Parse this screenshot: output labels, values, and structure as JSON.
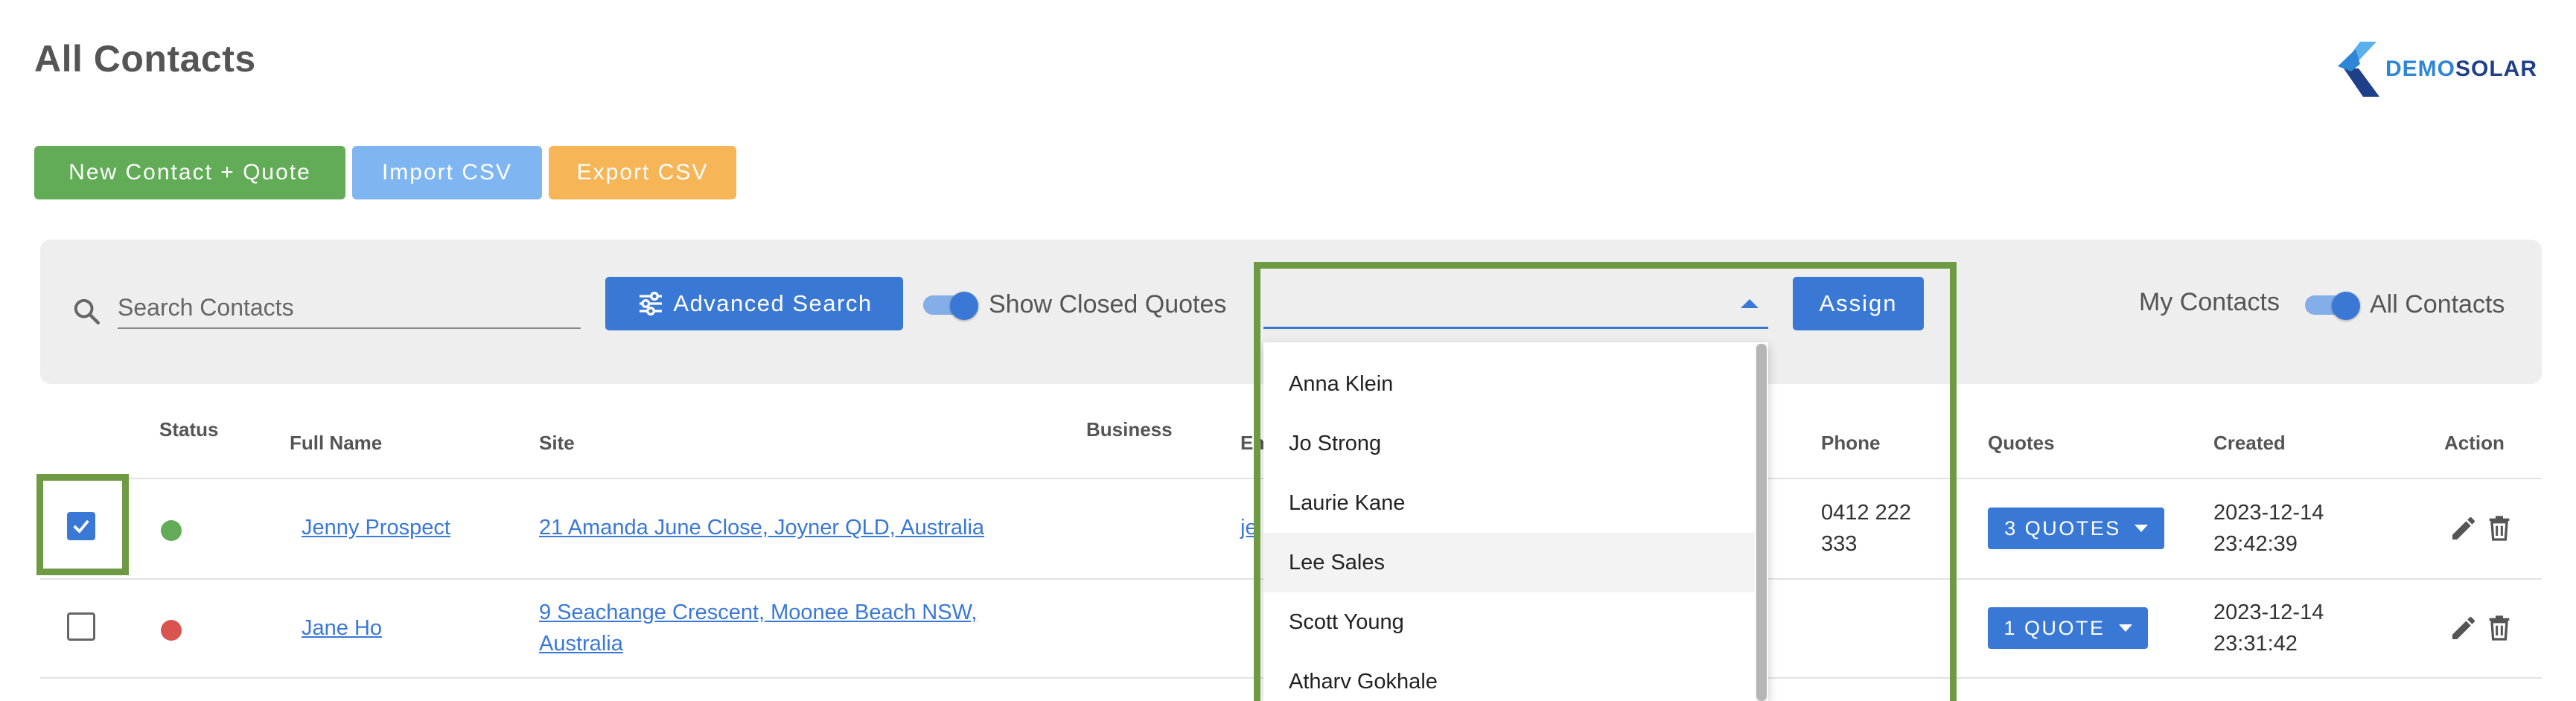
{
  "page": {
    "title": "All Contacts"
  },
  "logo": {
    "text_part1": "DEMO",
    "text_part2": "SOLAR"
  },
  "actions": {
    "new_contact": "New Contact + Quote",
    "import_csv": "Import CSV",
    "export_csv": "Export CSV"
  },
  "toolbar": {
    "search_placeholder": "Search Contacts",
    "advanced_search": "Advanced Search",
    "show_closed_quotes_label": "Show Closed Quotes",
    "show_closed_quotes_on": true,
    "assign_select_value": "",
    "assign_button": "Assign",
    "my_contacts_label": "My Contacts",
    "all_contacts_label": "All Contacts",
    "all_contacts_on": true
  },
  "assign_dropdown": {
    "options": [
      "Anna Klein",
      "Jo Strong",
      "Laurie Kane",
      "Lee Sales",
      "Scott Young",
      "Atharv Gokhale"
    ],
    "hovered": "Lee Sales"
  },
  "table": {
    "columns": {
      "status": "Status",
      "full_name": "Full Name",
      "site": "Site",
      "business": "Business",
      "email": "Email",
      "phone": "Phone",
      "quotes": "Quotes",
      "created": "Created",
      "action": "Action"
    },
    "rows": [
      {
        "selected": true,
        "status_color": "#62ac58",
        "full_name": "Jenny Prospect",
        "site": "21 Amanda June Close, Joyner QLD, Australia",
        "business": "",
        "email_visible": "je",
        "phone_line1": "0412 222",
        "phone_line2": "333",
        "quotes_label": "3 QUOTES",
        "created_date": "2023-12-14",
        "created_time": "23:42:39"
      },
      {
        "selected": false,
        "status_color": "#d9534f",
        "full_name": "Jane Ho",
        "site_line1": "9 Seachange Crescent, Moonee Beach NSW,",
        "site_line2": "Australia",
        "business": "",
        "email_visible": "",
        "phone_line1": "",
        "phone_line2": "",
        "quotes_label": "1 QUOTE",
        "created_date": "2023-12-14",
        "created_time": "23:31:42"
      }
    ]
  },
  "colors": {
    "primary": "#3a78d6",
    "success": "#62ac58",
    "info": "#7fb6f1",
    "warning": "#f6b658",
    "danger": "#d9534f",
    "highlight": "#6e9a43"
  },
  "icons": {
    "search": "search-icon",
    "tune": "tune-icon",
    "edit": "pencil-icon",
    "delete": "trash-icon",
    "caret": "caret-down-icon"
  }
}
